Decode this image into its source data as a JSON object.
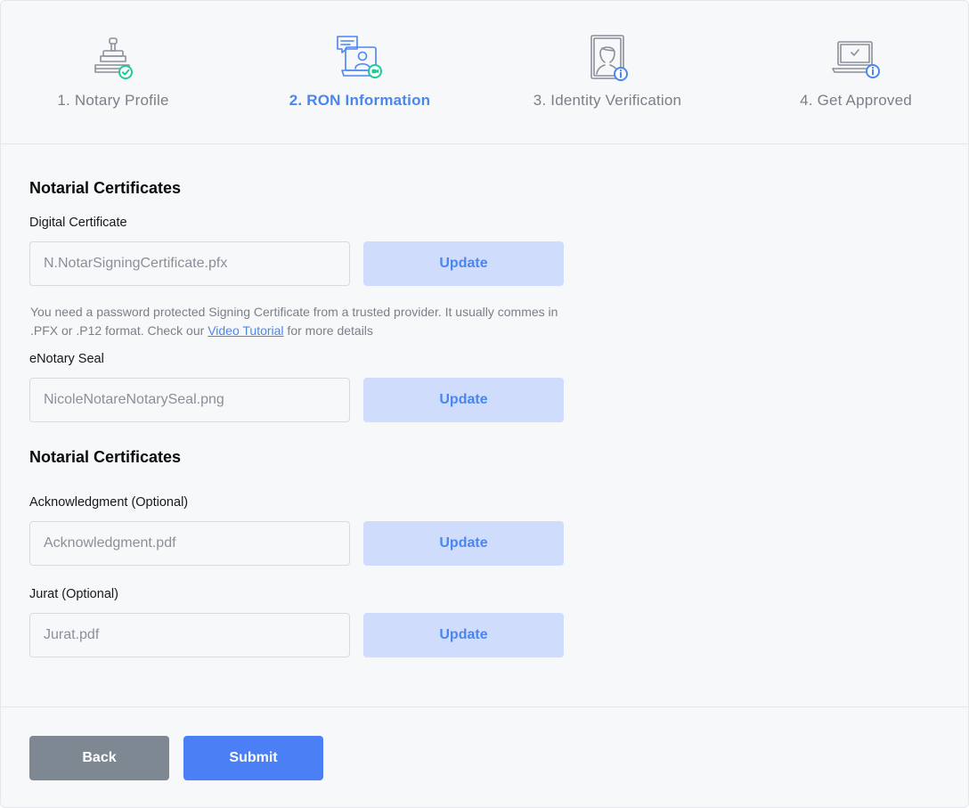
{
  "stepper": {
    "steps": [
      {
        "label": "1. Notary Profile",
        "icon": "notary-stamp-icon",
        "active": false
      },
      {
        "label": "2. RON Information",
        "icon": "video-notary-icon",
        "active": true
      },
      {
        "label": "3. Identity Verification",
        "icon": "id-card-icon",
        "active": false
      },
      {
        "label": "4. Get Approved",
        "icon": "laptop-check-icon",
        "active": false
      }
    ]
  },
  "colors": {
    "accent": "#4a86f0",
    "success": "#20c997",
    "muted": "#7a8089",
    "update_bg": "#cfdcfc",
    "back_bg": "#7e8893",
    "submit_bg": "#4a7ff5"
  },
  "certificates": {
    "title": "Notarial Certificates",
    "digital": {
      "label": "Digital Certificate",
      "value": "N.NotarSigningCertificate.pfx",
      "button": "Update"
    },
    "help": {
      "text_before": "You need a password protected Signing Certificate from a trusted provider. It usually commes in .PFX or .P12 format. Check our ",
      "link": "Video Tutorial",
      "text_after": " for more details"
    },
    "seal": {
      "label": "eNotary Seal",
      "value": "NicoleNotareNotarySeal.png",
      "button": "Update"
    }
  },
  "templates": {
    "title": "Notarial Certificates",
    "acknowledgment": {
      "label": "Acknowledgment (Optional)",
      "value": "Acknowledgment.pdf",
      "button": "Update"
    },
    "jurat": {
      "label": "Jurat (Optional)",
      "value": "Jurat.pdf",
      "button": "Update"
    }
  },
  "footer": {
    "back_label": "Back",
    "submit_label": "Submit"
  }
}
